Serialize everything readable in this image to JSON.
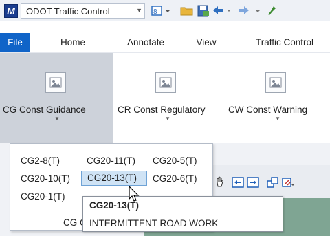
{
  "app": {
    "logo_text": "M",
    "workspace": "ODOT Traffic Control"
  },
  "quick_access": {
    "icons": [
      "workspace-dropdown-icon",
      "view-icon",
      "open-folder-icon",
      "save-icon",
      "undo-icon",
      "redo-icon",
      "pin-icon"
    ]
  },
  "tabs": [
    {
      "label": "File"
    },
    {
      "label": "Home"
    },
    {
      "label": "Annotate"
    },
    {
      "label": "View"
    },
    {
      "label": "Traffic Control"
    }
  ],
  "ribbon": {
    "gallery": [
      {
        "label": "CG Const Guidance",
        "icon": "image-icon",
        "state": "active"
      },
      {
        "label": "CR Const Regulatory",
        "icon": "image-icon",
        "state": "normal"
      },
      {
        "label": "CW Const Warning",
        "icon": "image-icon",
        "state": "normal"
      }
    ]
  },
  "dropdown": {
    "items": [
      [
        "CG2-8(T)",
        "CG20-11(T)",
        "CG20-5(T)"
      ],
      [
        "CG20-10(T)",
        "CG20-13(T)",
        "CG20-6(T)"
      ],
      [
        "CG20-1(T)"
      ]
    ],
    "hovered": "CG20-13(T)",
    "partial_row_text": "CG C"
  },
  "tooltip": {
    "title": "CG20-13(T)",
    "description": "INTERMITTENT ROAD WORK"
  },
  "colors": {
    "file_tab": "#1064c8",
    "active_gallery_bg": "#cdd2da",
    "hover_item_bg": "#cfe3f5",
    "hover_item_border": "#6fa3d6"
  }
}
